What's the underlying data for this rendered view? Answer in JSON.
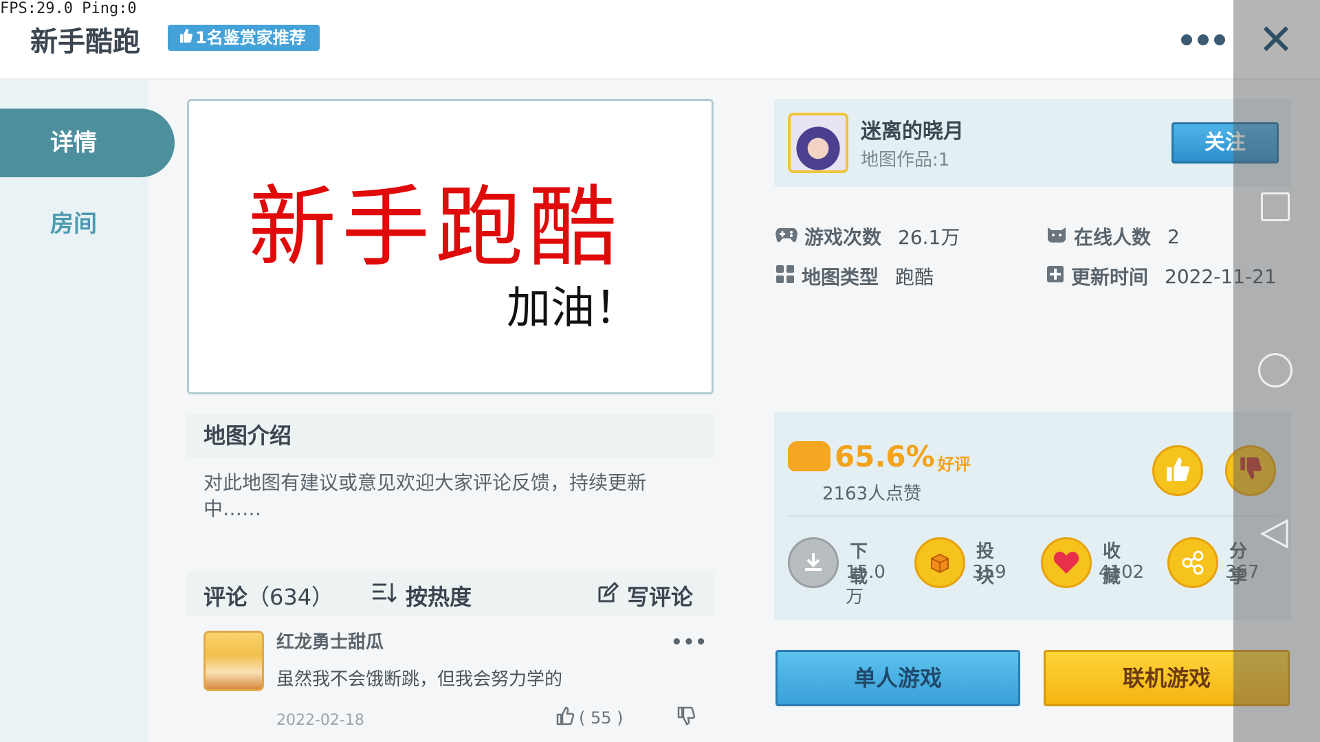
{
  "overlay": {
    "fps": "FPS:29.0  Ping:0"
  },
  "header": {
    "title": "新手酷跑",
    "badge": "1名鉴赏家推荐",
    "close_glyph": "✕"
  },
  "sidebar": {
    "tabs": [
      {
        "label": "详情",
        "active": true
      },
      {
        "label": "房间",
        "active": false
      }
    ]
  },
  "banner": {
    "line1": "新手跑酷",
    "line2": "加油！"
  },
  "intro": {
    "heading": "地图介绍",
    "body": "对此地图有建议或意见欢迎大家评论反馈，持续更新中……"
  },
  "comments": {
    "title": "评论",
    "count": "（634）",
    "sort_label": "按热度",
    "write_label": "写评论",
    "items": [
      {
        "user": "红龙勇士甜瓜",
        "text": "虽然我不会饿断跳，但我会努力学的",
        "date": "2022-02-18",
        "likes": "( 55 )",
        "more": "•••"
      }
    ]
  },
  "author": {
    "name": "迷离的晓月",
    "works": "地图作品:1",
    "follow_label": "关注"
  },
  "stats": {
    "plays_label": "游戏次数",
    "plays_value": "26.1万",
    "online_label": "在线人数",
    "online_value": "2",
    "type_label": "地图类型",
    "type_value": "跑酷",
    "updated_label": "更新时间",
    "updated_value": "2022-11-21"
  },
  "rating": {
    "percent": "65.6%",
    "word": "好评",
    "count": "2163人点赞"
  },
  "actions": [
    {
      "label": "下载",
      "value": "15.0万",
      "icon": "download-icon",
      "color": "#b8bdc0"
    },
    {
      "label": "投块",
      "value": "359",
      "icon": "block-icon",
      "color": "#f6c21c"
    },
    {
      "label": "收藏",
      "value": "4102",
      "icon": "heart-icon",
      "color": "#f6c21c"
    },
    {
      "label": "分享",
      "value": "367",
      "icon": "share-icon",
      "color": "#f6c21c"
    }
  ],
  "buttons": {
    "single": "单人游戏",
    "multi": "联机游戏"
  },
  "colors": {
    "accent_teal": "#4d8f9d",
    "accent_blue": "#44a2d8",
    "accent_yellow": "#f6c21c",
    "banner_red": "#e00a0a"
  }
}
